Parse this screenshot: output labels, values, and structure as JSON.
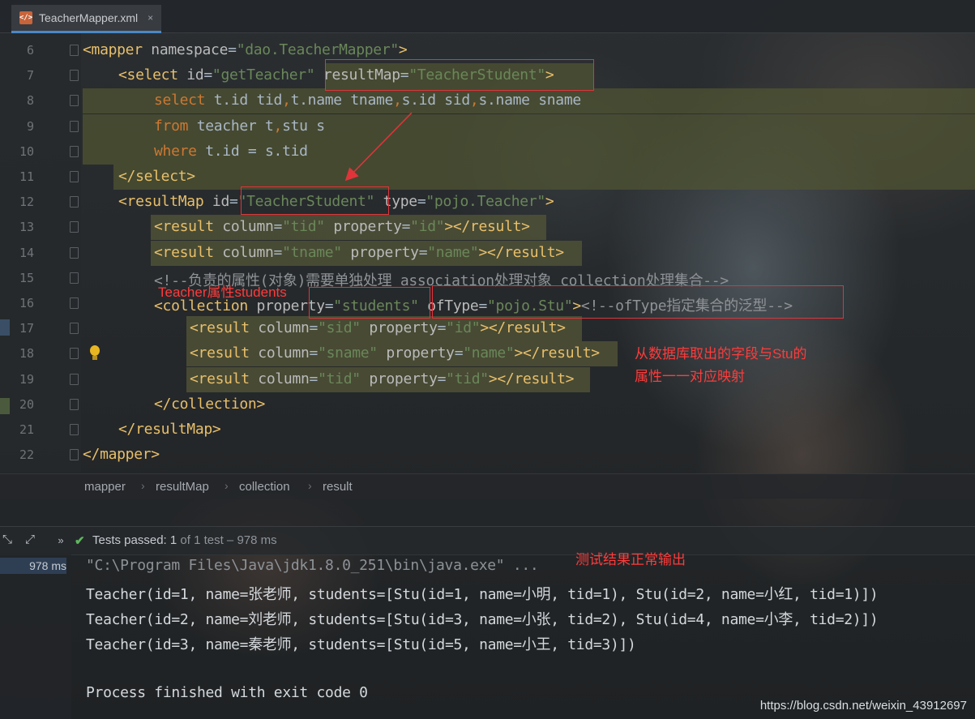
{
  "tab": {
    "icon": "xml-file-icon",
    "icon_text": "</>",
    "label": "TeacherMapper.xml",
    "close": "×"
  },
  "lines": [
    {
      "num": "6",
      "segs": [
        [
          "t",
          "<mapper "
        ],
        [
          "a",
          "namespace"
        ],
        [
          "p",
          "="
        ],
        [
          "v",
          "\"dao.TeacherMapper\""
        ],
        [
          "t",
          ">"
        ]
      ]
    },
    {
      "num": "7",
      "segs": [
        [
          "t",
          "<select "
        ],
        [
          "a",
          "id"
        ],
        [
          "p",
          "="
        ],
        [
          "v",
          "\"getTeacher\""
        ],
        [
          "p",
          " "
        ],
        [
          "a",
          "resultMap"
        ],
        [
          "p",
          "="
        ],
        [
          "v",
          "\"TeacherStudent\""
        ],
        [
          "t",
          ">"
        ]
      ]
    },
    {
      "num": "8",
      "segs": [
        [
          "k",
          "select "
        ],
        [
          "p",
          "t.id tid"
        ],
        [
          "k",
          ","
        ],
        [
          "p",
          "t.name tname"
        ],
        [
          "k",
          ","
        ],
        [
          "p",
          "s.id sid"
        ],
        [
          "k",
          ","
        ],
        [
          "p",
          "s.name sname"
        ]
      ]
    },
    {
      "num": "9",
      "segs": [
        [
          "k",
          "from "
        ],
        [
          "p",
          "teacher t"
        ],
        [
          "k",
          ","
        ],
        [
          "p",
          "stu s"
        ]
      ]
    },
    {
      "num": "10",
      "segs": [
        [
          "k",
          "where "
        ],
        [
          "p",
          "t.id = s.tid"
        ]
      ]
    },
    {
      "num": "11",
      "segs": [
        [
          "t",
          "</select>"
        ]
      ]
    },
    {
      "num": "12",
      "segs": [
        [
          "t",
          "<resultMap "
        ],
        [
          "a",
          "id"
        ],
        [
          "p",
          "="
        ],
        [
          "v",
          "\"TeacherStudent\""
        ],
        [
          "p",
          " "
        ],
        [
          "a",
          "type"
        ],
        [
          "p",
          "="
        ],
        [
          "v",
          "\"pojo.Teacher\""
        ],
        [
          "t",
          ">"
        ]
      ]
    },
    {
      "num": "13",
      "segs": [
        [
          "t",
          "<result "
        ],
        [
          "a",
          "column"
        ],
        [
          "p",
          "="
        ],
        [
          "v",
          "\"tid\""
        ],
        [
          "p",
          " "
        ],
        [
          "a",
          "property"
        ],
        [
          "p",
          "="
        ],
        [
          "v",
          "\"id\""
        ],
        [
          "t",
          "></result>"
        ]
      ]
    },
    {
      "num": "14",
      "segs": [
        [
          "t",
          "<result "
        ],
        [
          "a",
          "column"
        ],
        [
          "p",
          "="
        ],
        [
          "v",
          "\"tname\""
        ],
        [
          "p",
          " "
        ],
        [
          "a",
          "property"
        ],
        [
          "p",
          "="
        ],
        [
          "v",
          "\"name\""
        ],
        [
          "t",
          "></result>"
        ]
      ]
    },
    {
      "num": "15",
      "segs": [
        [
          "c",
          "<!--负责的属性(对象)需要单独处理 association处理对象 collection处理集合-->"
        ]
      ]
    },
    {
      "num": "16",
      "segs": [
        [
          "t",
          "<collection "
        ],
        [
          "a",
          "property"
        ],
        [
          "p",
          "="
        ],
        [
          "v",
          "\"students\""
        ],
        [
          "p",
          " "
        ],
        [
          "a",
          "ofType"
        ],
        [
          "p",
          "="
        ],
        [
          "v",
          "\"pojo.Stu\""
        ],
        [
          "t",
          ">"
        ],
        [
          "c",
          "<!--ofType指定集合的泛型-->"
        ]
      ]
    },
    {
      "num": "17",
      "segs": [
        [
          "t",
          "<result "
        ],
        [
          "a",
          "column"
        ],
        [
          "p",
          "="
        ],
        [
          "v",
          "\"sid\""
        ],
        [
          "p",
          " "
        ],
        [
          "a",
          "property"
        ],
        [
          "p",
          "="
        ],
        [
          "v",
          "\"id\""
        ],
        [
          "t",
          "></result>"
        ]
      ]
    },
    {
      "num": "18",
      "segs": [
        [
          "t",
          "<result "
        ],
        [
          "a",
          "column"
        ],
        [
          "p",
          "="
        ],
        [
          "v",
          "\"sname\""
        ],
        [
          "p",
          " "
        ],
        [
          "a",
          "property"
        ],
        [
          "p",
          "="
        ],
        [
          "v",
          "\"name\""
        ],
        [
          "t",
          "></result>"
        ]
      ]
    },
    {
      "num": "19",
      "segs": [
        [
          "t",
          "<result "
        ],
        [
          "a",
          "column"
        ],
        [
          "p",
          "="
        ],
        [
          "v",
          "\"tid\""
        ],
        [
          "p",
          " "
        ],
        [
          "a",
          "property"
        ],
        [
          "p",
          "="
        ],
        [
          "v",
          "\"tid\""
        ],
        [
          "t",
          "></result>"
        ]
      ]
    },
    {
      "num": "20",
      "segs": [
        [
          "t",
          "</collection>"
        ]
      ]
    },
    {
      "num": "21",
      "segs": [
        [
          "t",
          "</resultMap>"
        ]
      ]
    },
    {
      "num": "22",
      "segs": [
        [
          "t",
          "</mapper>"
        ]
      ]
    }
  ],
  "annotations": {
    "teacher_students": "Teacher属性students",
    "mapping_note_1": "从数据库取出的字段与Stu的",
    "mapping_note_2": "属性一一对应映射",
    "test_note": "测试结果正常输出"
  },
  "breadcrumb": [
    "mapper",
    "resultMap",
    "collection",
    "result"
  ],
  "run": {
    "status_main": "Tests passed: ",
    "status_count": "1",
    "status_rest": " of 1 test – 978 ms",
    "duration": "978 ms",
    "console": [
      "\"C:\\Program Files\\Java\\jdk1.8.0_251\\bin\\java.exe\" ...",
      "Teacher(id=1, name=张老师, students=[Stu(id=1, name=小明, tid=1), Stu(id=2, name=小红, tid=1)])",
      "Teacher(id=2, name=刘老师, students=[Stu(id=3, name=小张, tid=2), Stu(id=4, name=小李, tid=2)])",
      "Teacher(id=3, name=秦老师, students=[Stu(id=5, name=小王, tid=3)])",
      "",
      "Process finished with exit code 0"
    ]
  },
  "watermark": "https://blog.csdn.net/weixin_43912697",
  "colors": {
    "tag": "#e8bf6a",
    "attr": "#bababa",
    "value": "#6a8759",
    "keyword": "#cc7832",
    "annotation": "#ff3b3b",
    "pass": "#5fb85f"
  }
}
